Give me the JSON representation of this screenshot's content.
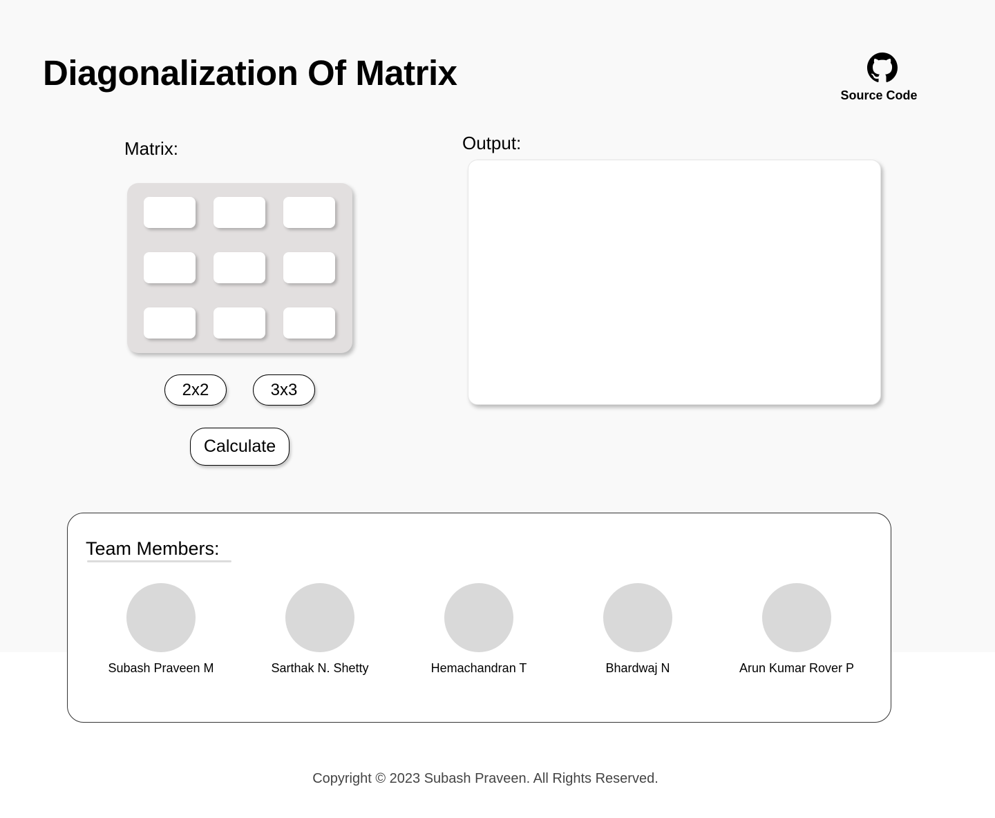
{
  "header": {
    "title": "Diagonalization Of Matrix",
    "source_code_label": "Source Code",
    "source_icon": "github-icon"
  },
  "matrix": {
    "label": "Matrix:",
    "cells": [
      [
        "",
        "",
        ""
      ],
      [
        "",
        "",
        ""
      ],
      [
        "",
        "",
        ""
      ]
    ],
    "size_buttons": [
      "2x2",
      "3x3"
    ],
    "calculate_label": "Calculate"
  },
  "output": {
    "label": "Output:",
    "content": ""
  },
  "team": {
    "heading": "Team Members:",
    "members": [
      {
        "name": "Subash Praveen M"
      },
      {
        "name": "Sarthak N. Shetty"
      },
      {
        "name": "Hemachandran T"
      },
      {
        "name": "Bhardwaj N"
      },
      {
        "name": "Arun Kumar Rover P"
      }
    ]
  },
  "footer": {
    "copyright": "Copyright © 2023 Subash Praveen. All Rights Reserved."
  },
  "colors": {
    "page_background": "#f9f9f9",
    "matrix_panel": "#e2dfdf",
    "avatar_placeholder": "#d9d9d9",
    "text": "#000000",
    "footer_text": "#444444"
  }
}
